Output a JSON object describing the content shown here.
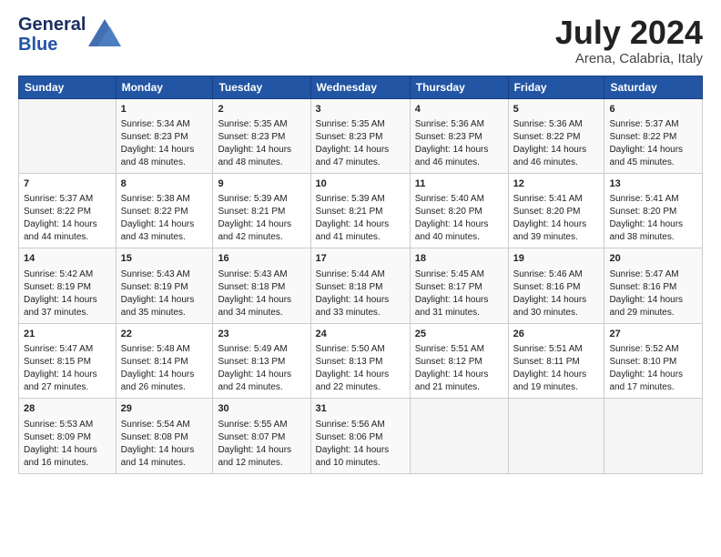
{
  "logo": {
    "line1": "General",
    "line2": "Blue"
  },
  "title": "July 2024",
  "subtitle": "Arena, Calabria, Italy",
  "days_of_week": [
    "Sunday",
    "Monday",
    "Tuesday",
    "Wednesday",
    "Thursday",
    "Friday",
    "Saturday"
  ],
  "weeks": [
    [
      {
        "day": "",
        "content": ""
      },
      {
        "day": "1",
        "content": "Sunrise: 5:34 AM\nSunset: 8:23 PM\nDaylight: 14 hours\nand 48 minutes."
      },
      {
        "day": "2",
        "content": "Sunrise: 5:35 AM\nSunset: 8:23 PM\nDaylight: 14 hours\nand 48 minutes."
      },
      {
        "day": "3",
        "content": "Sunrise: 5:35 AM\nSunset: 8:23 PM\nDaylight: 14 hours\nand 47 minutes."
      },
      {
        "day": "4",
        "content": "Sunrise: 5:36 AM\nSunset: 8:23 PM\nDaylight: 14 hours\nand 46 minutes."
      },
      {
        "day": "5",
        "content": "Sunrise: 5:36 AM\nSunset: 8:22 PM\nDaylight: 14 hours\nand 46 minutes."
      },
      {
        "day": "6",
        "content": "Sunrise: 5:37 AM\nSunset: 8:22 PM\nDaylight: 14 hours\nand 45 minutes."
      }
    ],
    [
      {
        "day": "7",
        "content": "Sunrise: 5:37 AM\nSunset: 8:22 PM\nDaylight: 14 hours\nand 44 minutes."
      },
      {
        "day": "8",
        "content": "Sunrise: 5:38 AM\nSunset: 8:22 PM\nDaylight: 14 hours\nand 43 minutes."
      },
      {
        "day": "9",
        "content": "Sunrise: 5:39 AM\nSunset: 8:21 PM\nDaylight: 14 hours\nand 42 minutes."
      },
      {
        "day": "10",
        "content": "Sunrise: 5:39 AM\nSunset: 8:21 PM\nDaylight: 14 hours\nand 41 minutes."
      },
      {
        "day": "11",
        "content": "Sunrise: 5:40 AM\nSunset: 8:20 PM\nDaylight: 14 hours\nand 40 minutes."
      },
      {
        "day": "12",
        "content": "Sunrise: 5:41 AM\nSunset: 8:20 PM\nDaylight: 14 hours\nand 39 minutes."
      },
      {
        "day": "13",
        "content": "Sunrise: 5:41 AM\nSunset: 8:20 PM\nDaylight: 14 hours\nand 38 minutes."
      }
    ],
    [
      {
        "day": "14",
        "content": "Sunrise: 5:42 AM\nSunset: 8:19 PM\nDaylight: 14 hours\nand 37 minutes."
      },
      {
        "day": "15",
        "content": "Sunrise: 5:43 AM\nSunset: 8:19 PM\nDaylight: 14 hours\nand 35 minutes."
      },
      {
        "day": "16",
        "content": "Sunrise: 5:43 AM\nSunset: 8:18 PM\nDaylight: 14 hours\nand 34 minutes."
      },
      {
        "day": "17",
        "content": "Sunrise: 5:44 AM\nSunset: 8:18 PM\nDaylight: 14 hours\nand 33 minutes."
      },
      {
        "day": "18",
        "content": "Sunrise: 5:45 AM\nSunset: 8:17 PM\nDaylight: 14 hours\nand 31 minutes."
      },
      {
        "day": "19",
        "content": "Sunrise: 5:46 AM\nSunset: 8:16 PM\nDaylight: 14 hours\nand 30 minutes."
      },
      {
        "day": "20",
        "content": "Sunrise: 5:47 AM\nSunset: 8:16 PM\nDaylight: 14 hours\nand 29 minutes."
      }
    ],
    [
      {
        "day": "21",
        "content": "Sunrise: 5:47 AM\nSunset: 8:15 PM\nDaylight: 14 hours\nand 27 minutes."
      },
      {
        "day": "22",
        "content": "Sunrise: 5:48 AM\nSunset: 8:14 PM\nDaylight: 14 hours\nand 26 minutes."
      },
      {
        "day": "23",
        "content": "Sunrise: 5:49 AM\nSunset: 8:13 PM\nDaylight: 14 hours\nand 24 minutes."
      },
      {
        "day": "24",
        "content": "Sunrise: 5:50 AM\nSunset: 8:13 PM\nDaylight: 14 hours\nand 22 minutes."
      },
      {
        "day": "25",
        "content": "Sunrise: 5:51 AM\nSunset: 8:12 PM\nDaylight: 14 hours\nand 21 minutes."
      },
      {
        "day": "26",
        "content": "Sunrise: 5:51 AM\nSunset: 8:11 PM\nDaylight: 14 hours\nand 19 minutes."
      },
      {
        "day": "27",
        "content": "Sunrise: 5:52 AM\nSunset: 8:10 PM\nDaylight: 14 hours\nand 17 minutes."
      }
    ],
    [
      {
        "day": "28",
        "content": "Sunrise: 5:53 AM\nSunset: 8:09 PM\nDaylight: 14 hours\nand 16 minutes."
      },
      {
        "day": "29",
        "content": "Sunrise: 5:54 AM\nSunset: 8:08 PM\nDaylight: 14 hours\nand 14 minutes."
      },
      {
        "day": "30",
        "content": "Sunrise: 5:55 AM\nSunset: 8:07 PM\nDaylight: 14 hours\nand 12 minutes."
      },
      {
        "day": "31",
        "content": "Sunrise: 5:56 AM\nSunset: 8:06 PM\nDaylight: 14 hours\nand 10 minutes."
      },
      {
        "day": "",
        "content": ""
      },
      {
        "day": "",
        "content": ""
      },
      {
        "day": "",
        "content": ""
      }
    ]
  ]
}
